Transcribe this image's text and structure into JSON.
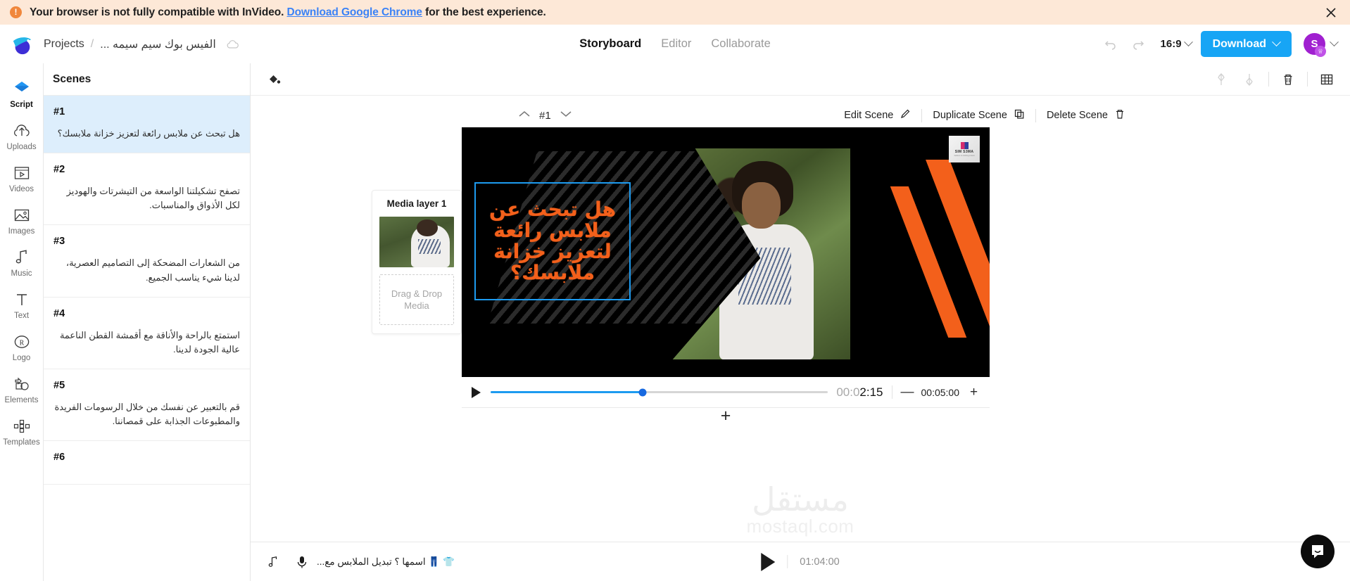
{
  "banner": {
    "icon": "alert-icon",
    "text_before": "Your browser is not fully compatible with InVideo. ",
    "link": "Download Google Chrome",
    "text_after": " for the best experience.",
    "close_icon": "close-icon",
    "bg_color": "#fde8d7",
    "link_color": "#3b82f6"
  },
  "header": {
    "logo": "invideo-logo",
    "breadcrumb": {
      "root": "Projects",
      "separator": "/",
      "project_name": "الفيس بوك سيم سيمه ...",
      "cloud_icon": "cloud-saved-icon"
    },
    "tabs": [
      {
        "label": "Storyboard",
        "active": true
      },
      {
        "label": "Editor",
        "active": false
      },
      {
        "label": "Collaborate",
        "active": false
      }
    ],
    "undo_icon": "undo-icon",
    "redo_icon": "redo-icon",
    "aspect_ratio": "16:9",
    "download_label": "Download",
    "download_color": "#17a5f5",
    "avatar_initial": "S",
    "avatar_color": "#a020d0",
    "crown_badge": "crown-icon"
  },
  "rail": {
    "items": [
      {
        "label": "Script",
        "icon": "script-icon",
        "active": true
      },
      {
        "label": "Uploads",
        "icon": "upload-cloud-icon",
        "active": false
      },
      {
        "label": "Videos",
        "icon": "video-icon",
        "active": false
      },
      {
        "label": "Images",
        "icon": "image-icon",
        "active": false
      },
      {
        "label": "Music",
        "icon": "music-note-icon",
        "active": false
      },
      {
        "label": "Text",
        "icon": "text-t-icon",
        "active": false
      },
      {
        "label": "Logo",
        "icon": "registered-r-icon",
        "active": false
      },
      {
        "label": "Elements",
        "icon": "elements-shapes-icon",
        "active": false
      },
      {
        "label": "Templates",
        "icon": "templates-grid-icon",
        "active": false
      }
    ]
  },
  "scenes_panel": {
    "title": "Scenes",
    "scenes": [
      {
        "number": "#1",
        "text": "هل تبحث عن ملابس رائعة لتعزيز خزانة ملابسك؟",
        "active": true
      },
      {
        "number": "#2",
        "text": "تصفح تشكيلتنا الواسعة من التيشرتات والهوديز لكل الأذواق والمناسبات.",
        "active": false
      },
      {
        "number": "#3",
        "text": "من الشعارات المضحكة إلى التصاميم العصرية، لدينا شيء يناسب الجميع.",
        "active": false
      },
      {
        "number": "#4",
        "text": "استمتع بالراحة والأناقة مع أقمشة القطن الناعمة عالية الجودة لدينا.",
        "active": false
      },
      {
        "number": "#5",
        "text": "قم بالتعبير عن نفسك من خلال الرسومات الفريدة والمطبوعات الجذابة على قمصاننا.",
        "active": false
      },
      {
        "number": "#6",
        "text": "",
        "active": false
      }
    ]
  },
  "editor_toolbar": {
    "fill_icon": "paint-bucket-icon",
    "move_up_icon": "move-up-icon",
    "move_down_icon": "move-down-icon",
    "delete_icon": "trash-icon",
    "layout_icon": "grid-layout-icon"
  },
  "scene_controls": {
    "up_icon": "chevron-up-icon",
    "down_icon": "chevron-down-icon",
    "scene_number": "#1",
    "edit_label": "Edit Scene",
    "edit_icon": "pencil-icon",
    "duplicate_label": "Duplicate Scene",
    "duplicate_icon": "copy-icon",
    "delete_label": "Delete Scene",
    "delete_icon": "trash-icon"
  },
  "media_layer": {
    "title": "Media layer 1",
    "thumbnail": "person-tshirt-thumbnail",
    "dropzone_line1": "Drag & Drop",
    "dropzone_line2": "Media"
  },
  "canvas": {
    "headline": [
      "هل تبحث عن",
      "ملابس رائعة",
      "لتعزيز خزانة",
      "ملابسك؟"
    ],
    "headline_color": "#f3601b",
    "selection_color": "#1d9bf0",
    "background_color": "#000000",
    "accent_color": "#f3601b",
    "logo_text": "SIM S3MA",
    "logo_sub": "fashion & clothing brand"
  },
  "player": {
    "play_icon": "play-icon",
    "progress_percent": 45,
    "current_time_dim": "00:0",
    "current_time_bold": "2:15",
    "minus_label": "—",
    "total_time": "00:05:00",
    "plus_label": "+"
  },
  "add_scene": {
    "label": "+"
  },
  "audio_bar": {
    "music_icon": "music-note-icon",
    "mic_icon": "microphone-icon",
    "track_text": "👕 👖 اسمها ؟ تبديل الملابس مع...",
    "big_play_icon": "play-icon",
    "timestamp": "01:04:00"
  },
  "watermark": {
    "arabic": "مستقل",
    "english": "mostaql.com"
  },
  "intercom": {
    "icon": "chat-bubble-icon"
  }
}
